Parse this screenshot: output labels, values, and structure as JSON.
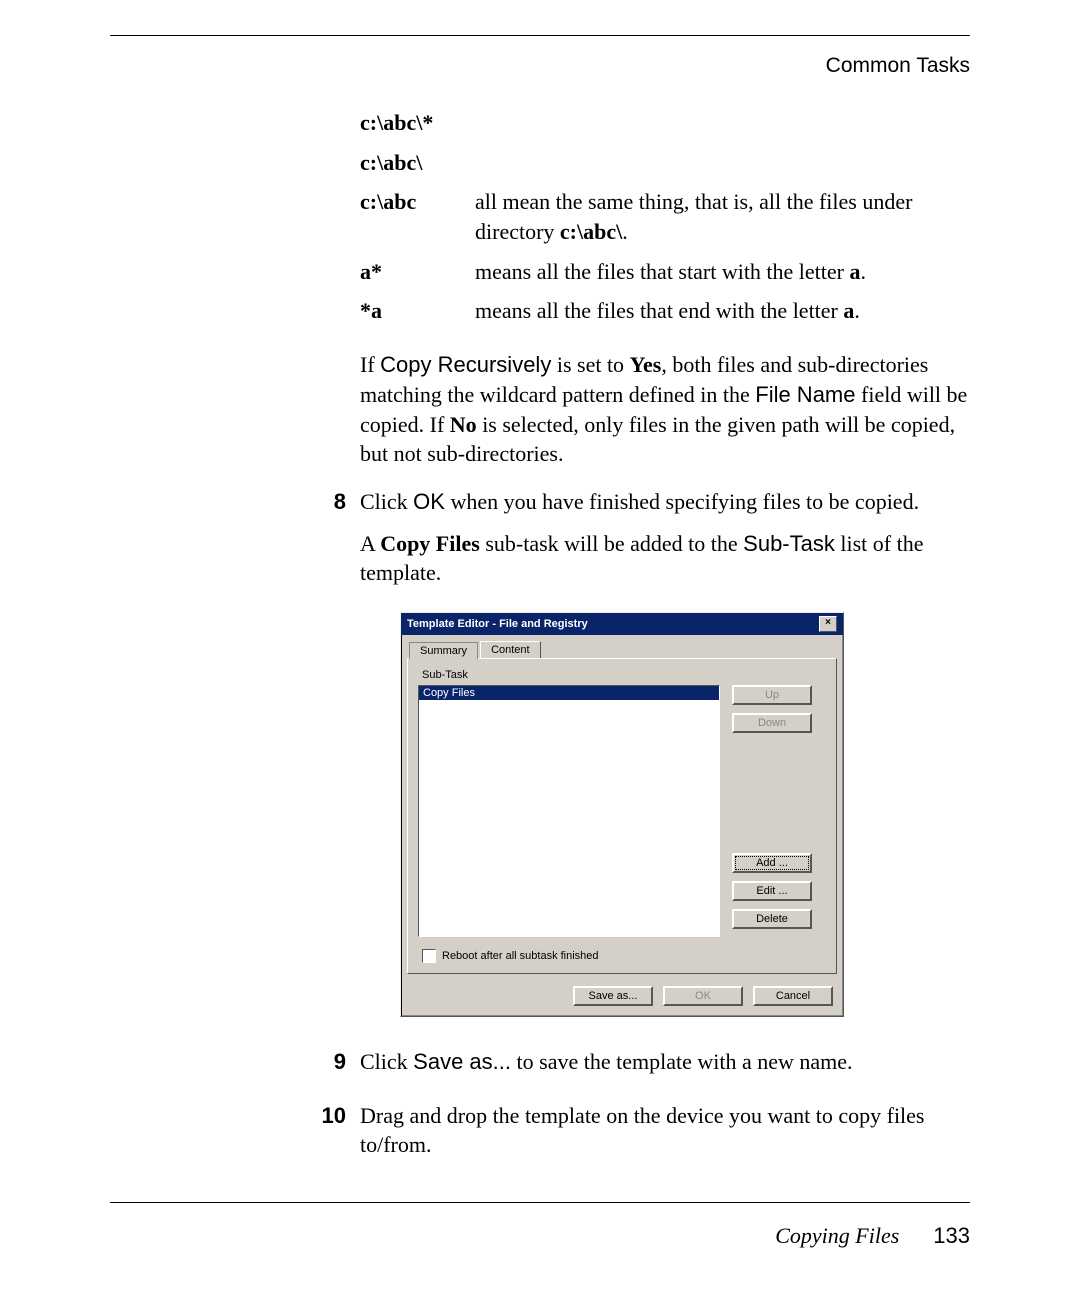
{
  "header": {
    "section": "Common Tasks"
  },
  "definitions": {
    "rows": [
      {
        "term": "c:\\abc\\*",
        "desc": ""
      },
      {
        "term": "c:\\abc\\",
        "desc": ""
      },
      {
        "term": "c:\\abc",
        "desc_pre": "all mean the same thing, that is, all the files under directory ",
        "desc_bold": "c:\\abc\\",
        "desc_post": "."
      },
      {
        "term": "a*",
        "desc_pre": "means all the files that start with the letter ",
        "desc_bold": "a",
        "desc_post": "."
      },
      {
        "term": "*a",
        "desc_pre": "means all the files that end with the letter ",
        "desc_bold": "a",
        "desc_post": "."
      }
    ],
    "note": {
      "p1a": "If ",
      "copy_rec": "Copy Recursively",
      "p1b": " is set to ",
      "yes": "Yes",
      "p1c": ", both files and sub-directories matching the wildcard pattern defined in the ",
      "file_name": "File Name",
      "p1d": " field will be copied. If ",
      "no": "No",
      "p1e": " is selected, only files in the given path will be copied, but not sub-directories."
    }
  },
  "steps": {
    "s8": {
      "num": "8",
      "p1a": "Click ",
      "ok": "OK",
      "p1b": " when you have finished specifying files to be copied.",
      "p2a": "A ",
      "copy_files": "Copy Files",
      "p2b": " sub-task will be added to the ",
      "subtask": "Sub-Task",
      "p2c": " list of the template."
    },
    "s9": {
      "num": "9",
      "p1a": "Click ",
      "save_as": "Save as...",
      "p1b": " to save the template with a new name."
    },
    "s10": {
      "num": "10",
      "p1": "Drag and drop the template on the device you want to copy files to/from."
    }
  },
  "dialog": {
    "title": "Template Editor - File and Registry",
    "close": "×",
    "tabs": {
      "summary": "Summary",
      "content": "Content"
    },
    "subtask_label": "Sub-Task",
    "selected_item": "Copy Files",
    "buttons": {
      "up": "Up",
      "down": "Down",
      "add": "Add ...",
      "edit": "Edit ...",
      "delete": "Delete"
    },
    "checkbox_label": "Reboot after all subtask finished",
    "bottom": {
      "save_as": "Save as...",
      "ok": "OK",
      "cancel": "Cancel"
    }
  },
  "footer": {
    "title": "Copying Files",
    "page": "133"
  }
}
